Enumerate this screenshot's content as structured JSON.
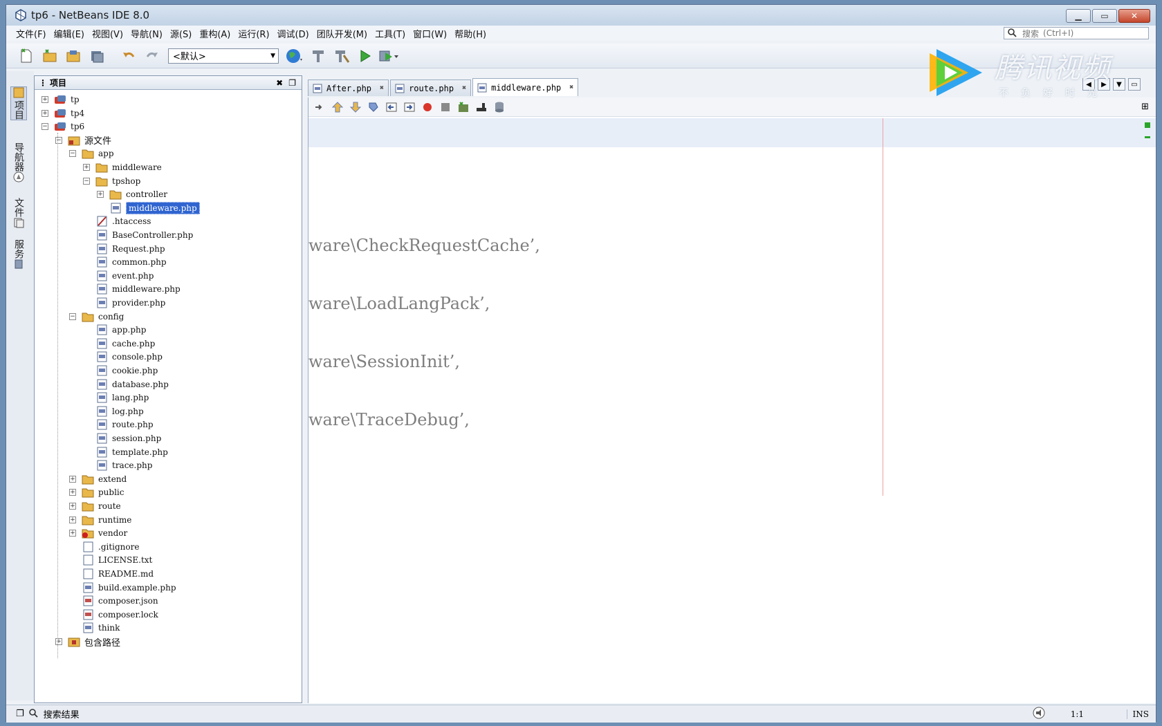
{
  "window": {
    "title": "tp6 - NetBeans IDE 8.0"
  },
  "menu": [
    "文件(F)",
    "编辑(E)",
    "视图(V)",
    "导航(N)",
    "源(S)",
    "重构(A)",
    "运行(R)",
    "调试(D)",
    "团队开发(M)",
    "工具(T)",
    "窗口(W)",
    "帮助(H)"
  ],
  "search": {
    "label": "搜索",
    "placeholder": "(Ctrl+I)"
  },
  "toolbar": {
    "config_value": "<默认>"
  },
  "watermark": {
    "brand": "腾讯视频",
    "slogan": "不负好时光"
  },
  "left_strip": [
    "项目",
    "导航器",
    "文件",
    "服务"
  ],
  "project_panel": {
    "title": "项目"
  },
  "tree": [
    {
      "label": "tp",
      "icon": "project-icon",
      "depth": 0,
      "expander": "+"
    },
    {
      "label": "tp4",
      "icon": "project-icon",
      "depth": 0,
      "expander": "+"
    },
    {
      "label": "tp6",
      "icon": "project-icon",
      "depth": 0,
      "expander": "-"
    },
    {
      "label": "源文件",
      "icon": "source-folder-icon",
      "depth": 1,
      "expander": "-"
    },
    {
      "label": "app",
      "icon": "folder-icon",
      "depth": 2,
      "expander": "-"
    },
    {
      "label": "middleware",
      "icon": "folder-icon",
      "depth": 3,
      "expander": "+"
    },
    {
      "label": "tpshop",
      "icon": "folder-icon",
      "depth": 3,
      "expander": "-"
    },
    {
      "label": "controller",
      "icon": "folder-icon",
      "depth": 4,
      "expander": "+"
    },
    {
      "label": "middleware.php",
      "icon": "php-file-icon",
      "depth": 4,
      "expander": "",
      "selected": true
    },
    {
      "label": ".htaccess",
      "icon": "htaccess-file-icon",
      "depth": 3,
      "expander": ""
    },
    {
      "label": "BaseController.php",
      "icon": "php-file-icon",
      "depth": 3,
      "expander": ""
    },
    {
      "label": "Request.php",
      "icon": "php-file-icon",
      "depth": 3,
      "expander": ""
    },
    {
      "label": "common.php",
      "icon": "php-file-icon",
      "depth": 3,
      "expander": ""
    },
    {
      "label": "event.php",
      "icon": "php-file-icon",
      "depth": 3,
      "expander": ""
    },
    {
      "label": "middleware.php",
      "icon": "php-file-icon",
      "depth": 3,
      "expander": ""
    },
    {
      "label": "provider.php",
      "icon": "php-file-icon",
      "depth": 3,
      "expander": ""
    },
    {
      "label": "config",
      "icon": "folder-icon",
      "depth": 2,
      "expander": "-"
    },
    {
      "label": "app.php",
      "icon": "php-file-icon",
      "depth": 3,
      "expander": ""
    },
    {
      "label": "cache.php",
      "icon": "php-file-icon",
      "depth": 3,
      "expander": ""
    },
    {
      "label": "console.php",
      "icon": "php-file-icon",
      "depth": 3,
      "expander": ""
    },
    {
      "label": "cookie.php",
      "icon": "php-file-icon",
      "depth": 3,
      "expander": ""
    },
    {
      "label": "database.php",
      "icon": "php-file-icon",
      "depth": 3,
      "expander": ""
    },
    {
      "label": "lang.php",
      "icon": "php-file-icon",
      "depth": 3,
      "expander": ""
    },
    {
      "label": "log.php",
      "icon": "php-file-icon",
      "depth": 3,
      "expander": ""
    },
    {
      "label": "route.php",
      "icon": "php-file-icon",
      "depth": 3,
      "expander": ""
    },
    {
      "label": "session.php",
      "icon": "php-file-icon",
      "depth": 3,
      "expander": ""
    },
    {
      "label": "template.php",
      "icon": "php-file-icon",
      "depth": 3,
      "expander": ""
    },
    {
      "label": "trace.php",
      "icon": "php-file-icon",
      "depth": 3,
      "expander": ""
    },
    {
      "label": "extend",
      "icon": "folder-icon",
      "depth": 2,
      "expander": "+"
    },
    {
      "label": "public",
      "icon": "folder-icon",
      "depth": 2,
      "expander": "+"
    },
    {
      "label": "route",
      "icon": "folder-icon",
      "depth": 2,
      "expander": "+"
    },
    {
      "label": "runtime",
      "icon": "folder-icon",
      "depth": 2,
      "expander": "+"
    },
    {
      "label": "vendor",
      "icon": "folder-error-icon",
      "depth": 2,
      "expander": "+"
    },
    {
      "label": ".gitignore",
      "icon": "text-file-icon",
      "depth": 2,
      "expander": ""
    },
    {
      "label": "LICENSE.txt",
      "icon": "text-file-icon",
      "depth": 2,
      "expander": ""
    },
    {
      "label": "README.md",
      "icon": "text-file-icon",
      "depth": 2,
      "expander": ""
    },
    {
      "label": "build.example.php",
      "icon": "php-file-icon",
      "depth": 2,
      "expander": ""
    },
    {
      "label": "composer.json",
      "icon": "json-file-icon",
      "depth": 2,
      "expander": ""
    },
    {
      "label": "composer.lock",
      "icon": "json-file-icon",
      "depth": 2,
      "expander": ""
    },
    {
      "label": "think",
      "icon": "php-file-icon",
      "depth": 2,
      "expander": ""
    },
    {
      "label": "包含路径",
      "icon": "library-icon",
      "depth": 1,
      "expander": "+"
    }
  ],
  "editor_tabs": [
    {
      "label": "After.php",
      "active": false
    },
    {
      "label": "route.php",
      "active": false
    },
    {
      "label": "middleware.php",
      "active": true
    }
  ],
  "code_lines": [
    "ware\\CheckRequestCache’,",
    "ware\\LoadLangPack’,",
    "ware\\SessionInit’,",
    "ware\\TraceDebug’,"
  ],
  "status": {
    "search_results": "搜索结果",
    "position": "1:1",
    "mode": "INS"
  },
  "colors": {
    "selection": "#2f64d0",
    "current_line": "#e8eef8",
    "margin": "#e9a3a3"
  }
}
